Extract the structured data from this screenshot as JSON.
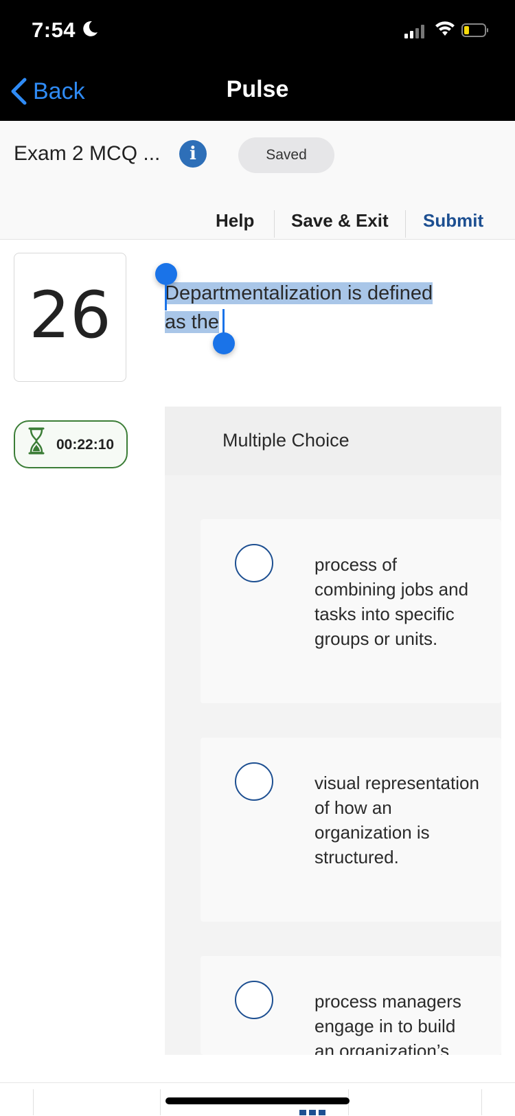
{
  "status_bar": {
    "time": "7:54"
  },
  "nav": {
    "back_label": "Back",
    "title": "Pulse"
  },
  "header": {
    "exam_title": "Exam 2 MCQ ...",
    "saved_label": "Saved",
    "help_label": "Help",
    "save_exit_label": "Save & Exit",
    "submit_label": "Submit"
  },
  "question": {
    "number": "26",
    "text_line1": "Departmentalization is defined",
    "text_line2": "as the"
  },
  "timer": {
    "value": "00:22:10"
  },
  "choices_panel": {
    "type_label": "Multiple Choice",
    "options": [
      {
        "text": "process of combining jobs and tasks into specific groups or units."
      },
      {
        "text": "visual representation of how an organization is structured."
      },
      {
        "text": "process managers engage in to build an organization’s"
      }
    ]
  },
  "colors": {
    "accent_blue": "#1d4f91",
    "ios_blue": "#2f8bf5",
    "timer_green": "#3b7d36",
    "selection_highlight": "#a9c6e8"
  }
}
